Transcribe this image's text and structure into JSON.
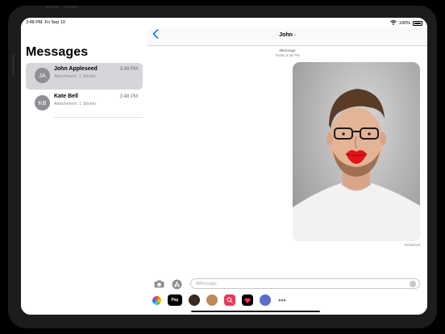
{
  "status_bar": {
    "time": "3:48 PM",
    "date": "Fri Sep 10",
    "battery": "100%"
  },
  "sidebar": {
    "title": "Messages",
    "conversations": [
      {
        "initials": "JA",
        "name": "John Appleseed",
        "time": "3:48 PM",
        "preview": "Attachment: 1 Sticker",
        "selected": true
      },
      {
        "initials": "KB",
        "name": "Kate Bell",
        "time": "3:48 PM",
        "preview": "Attachment: 1 Sticker",
        "selected": false
      }
    ]
  },
  "chat": {
    "back_icon": "chevron-left-icon",
    "contact_name": "John",
    "service_label": "iMessage",
    "timestamp": "Today 3:48 PM",
    "message_image": "photo of a smiling man with glasses and a red lips sticker",
    "delivered": "Delivered",
    "input_placeholder": "iMessage"
  },
  "app_drawer": {
    "apps": [
      "photos-app-icon",
      "apple-pay-app-icon",
      "memoji-app-icon",
      "memoji-stickers-app-icon",
      "search-images-app-icon",
      "digital-touch-app-icon",
      "sticker-app-icon",
      "more-apps-icon"
    ],
    "apple_pay_label": "Pay"
  },
  "colors": {
    "accent": "#007aff",
    "selected_row": "#d6d6da"
  }
}
